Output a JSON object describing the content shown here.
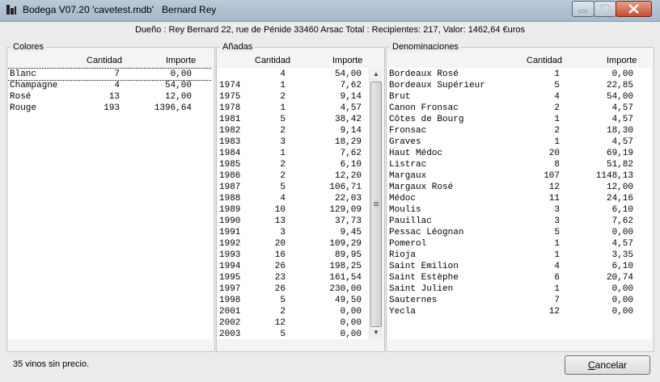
{
  "window": {
    "title": "Bodega V07.20 'cavetest.mdb'   Bernard Rey",
    "icon": "wine-bottle-icon"
  },
  "header_text": "Dueño : Rey Bernard 22, rue de Pénide 33460 Arsac Total : Recipientes: 217, Valor: 1462,64 €uros",
  "colores": {
    "label": "Colores",
    "col_cantidad": "Cantidad",
    "col_importe": "Importe",
    "rows": [
      {
        "name": "Blanc",
        "cantidad": "7",
        "importe": "0,00"
      },
      {
        "name": "Champagne",
        "cantidad": "4",
        "importe": "54,00"
      },
      {
        "name": "Rosé",
        "cantidad": "13",
        "importe": "12,00"
      },
      {
        "name": "Rouge",
        "cantidad": "193",
        "importe": "1396,64"
      }
    ]
  },
  "anadas": {
    "label": "Añadas",
    "col_cantidad": "Cantidad",
    "col_importe": "Importe",
    "rows": [
      {
        "name": "",
        "cantidad": "4",
        "importe": "54,00"
      },
      {
        "name": "1974",
        "cantidad": "1",
        "importe": "7,62"
      },
      {
        "name": "1975",
        "cantidad": "2",
        "importe": "9,14"
      },
      {
        "name": "1978",
        "cantidad": "1",
        "importe": "4,57"
      },
      {
        "name": "1981",
        "cantidad": "5",
        "importe": "38,42"
      },
      {
        "name": "1982",
        "cantidad": "2",
        "importe": "9,14"
      },
      {
        "name": "1983",
        "cantidad": "3",
        "importe": "18,29"
      },
      {
        "name": "1984",
        "cantidad": "1",
        "importe": "7,62"
      },
      {
        "name": "1985",
        "cantidad": "2",
        "importe": "6,10"
      },
      {
        "name": "1986",
        "cantidad": "2",
        "importe": "12,20"
      },
      {
        "name": "1987",
        "cantidad": "5",
        "importe": "106,71"
      },
      {
        "name": "1988",
        "cantidad": "4",
        "importe": "22,03"
      },
      {
        "name": "1989",
        "cantidad": "10",
        "importe": "129,09"
      },
      {
        "name": "1990",
        "cantidad": "13",
        "importe": "37,73"
      },
      {
        "name": "1991",
        "cantidad": "3",
        "importe": "9,45"
      },
      {
        "name": "1992",
        "cantidad": "20",
        "importe": "109,29"
      },
      {
        "name": "1993",
        "cantidad": "16",
        "importe": "89,95"
      },
      {
        "name": "1994",
        "cantidad": "26",
        "importe": "198,25"
      },
      {
        "name": "1995",
        "cantidad": "23",
        "importe": "161,54"
      },
      {
        "name": "1997",
        "cantidad": "26",
        "importe": "230,00"
      },
      {
        "name": "1998",
        "cantidad": "5",
        "importe": "49,50"
      },
      {
        "name": "2001",
        "cantidad": "2",
        "importe": "0,00"
      },
      {
        "name": "2002",
        "cantidad": "12",
        "importe": "0,00"
      },
      {
        "name": "2003",
        "cantidad": "5",
        "importe": "0,00"
      }
    ]
  },
  "denominaciones": {
    "label": "Denominaciones",
    "col_cantidad": "Cantidad",
    "col_importe": "Importe",
    "rows": [
      {
        "name": "Bordeaux Rosé",
        "cantidad": "1",
        "importe": "0,00"
      },
      {
        "name": "Bordeaux Supérieur",
        "cantidad": "5",
        "importe": "22,85"
      },
      {
        "name": "Brut",
        "cantidad": "4",
        "importe": "54,00"
      },
      {
        "name": "Canon Fronsac",
        "cantidad": "2",
        "importe": "4,57"
      },
      {
        "name": "Côtes de Bourg",
        "cantidad": "1",
        "importe": "4,57"
      },
      {
        "name": "Fronsac",
        "cantidad": "2",
        "importe": "18,30"
      },
      {
        "name": "Graves",
        "cantidad": "1",
        "importe": "4,57"
      },
      {
        "name": "Haut Médoc",
        "cantidad": "20",
        "importe": "69,19"
      },
      {
        "name": "Listrac",
        "cantidad": "8",
        "importe": "51,82"
      },
      {
        "name": "Margaux",
        "cantidad": "107",
        "importe": "1148,13"
      },
      {
        "name": "Margaux Rosé",
        "cantidad": "12",
        "importe": "12,00"
      },
      {
        "name": "Médoc",
        "cantidad": "11",
        "importe": "24,16"
      },
      {
        "name": "Moulis",
        "cantidad": "3",
        "importe": "6,10"
      },
      {
        "name": "Pauillac",
        "cantidad": "3",
        "importe": "7,62"
      },
      {
        "name": "Pessac Léognan",
        "cantidad": "5",
        "importe": "0,00"
      },
      {
        "name": "Pomerol",
        "cantidad": "1",
        "importe": "4,57"
      },
      {
        "name": "Rioja",
        "cantidad": "1",
        "importe": "3,35"
      },
      {
        "name": "Saint Emilion",
        "cantidad": "4",
        "importe": "6,10"
      },
      {
        "name": "Saint Estèphe",
        "cantidad": "6",
        "importe": "20,74"
      },
      {
        "name": "Saint Julien",
        "cantidad": "1",
        "importe": "0,00"
      },
      {
        "name": "Sauternes",
        "cantidad": "7",
        "importe": "0,00"
      },
      {
        "name": "Yecla",
        "cantidad": "12",
        "importe": "0,00"
      }
    ]
  },
  "status_text": "35 vinos sin precio.",
  "cancel_button": {
    "label_prefix": "C",
    "label_rest": "ancelar"
  }
}
